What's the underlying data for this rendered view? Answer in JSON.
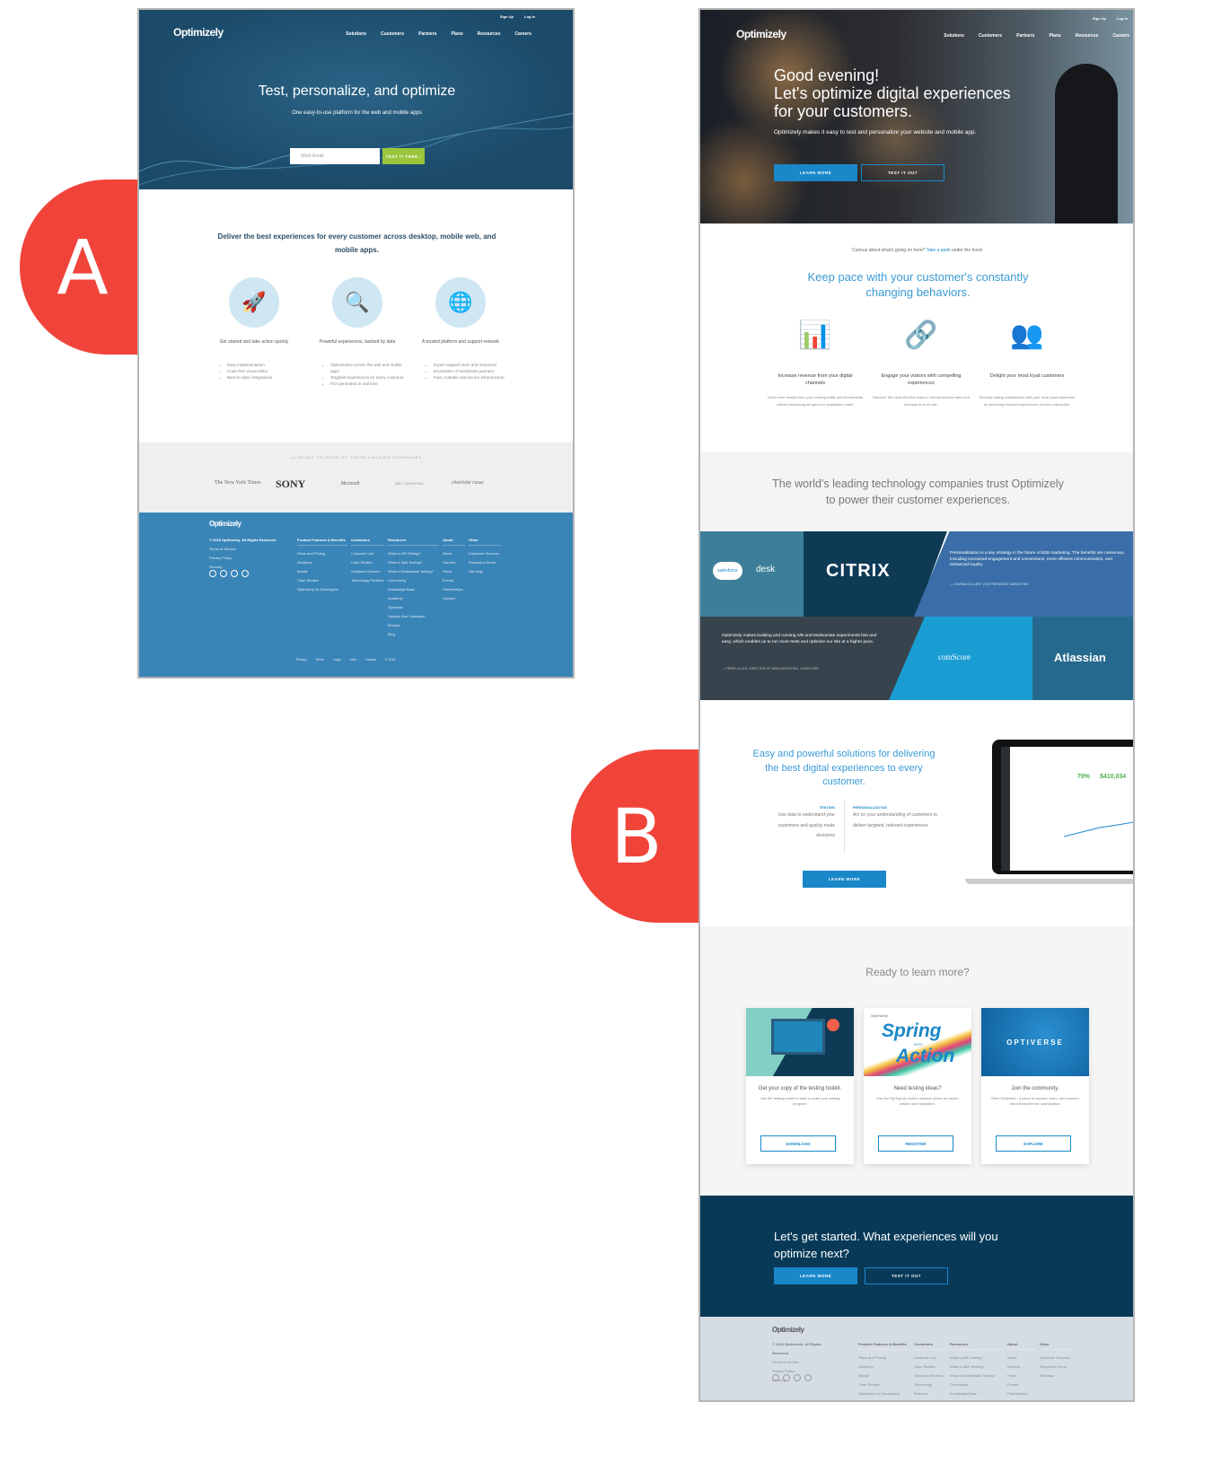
{
  "variant_a": {
    "badge": "A",
    "brand": "Optimizely",
    "top_links": [
      "Sign Up",
      "Log In"
    ],
    "nav": [
      "Solutions",
      "Customers",
      "Partners",
      "Plans",
      "Resources",
      "Careers"
    ],
    "hero": {
      "title": "Test, personalize, and optimize",
      "subtitle": "One easy-to-use platform for the web and mobile apps",
      "email_placeholder": "Work Email",
      "cta": "TEST IT FREE ›"
    },
    "section_title": "Deliver the best experiences for every customer across desktop, mobile web, and mobile apps.",
    "features": [
      {
        "icon": "rocket-icon",
        "title": "Get started and take action quickly",
        "bullets": [
          "Easy implementation",
          "Code-free visual editor",
          "Best-in-class integrations"
        ]
      },
      {
        "icon": "magnifier-icon",
        "title": "Powerful experiences, backed by data",
        "bullets": [
          "Optimization across the web and mobile apps",
          "Targeted experiences for every customer",
          "ROI generated in real time"
        ]
      },
      {
        "icon": "globe-icon",
        "title": "A trusted platform and support network",
        "bullets": [
          "Expert support team and resources",
          "Ecosystem of worldclass partners",
          "Fast, scalable and secure infrastructure"
        ]
      }
    ],
    "trusted_label": "ALREADY TRUSTED BY THESE AMAZING COMPANIES",
    "logos": [
      "The New York Times",
      "SONY",
      "Microsoft",
      "NBC UNIVERSAL",
      "charlotte russe"
    ],
    "footer": {
      "copyright": "© 2016 Optimizely. All Rights Reserved.",
      "links": [
        "Terms of Service",
        "Privacy Policy",
        "Security"
      ],
      "columns": [
        {
          "title": "Product Features & Benefits",
          "items": [
            "Plans and Pricing",
            "Solutions",
            "Mobile",
            "Case Studies",
            "Optimizely for Developers"
          ]
        },
        {
          "title": "Customers",
          "items": [
            "Customer List",
            "Case Studies",
            "Solutions Partners",
            "Technology Partners"
          ]
        },
        {
          "title": "Resources",
          "items": [
            "What is A/B Testing?",
            "What is Split Testing?",
            "What is Multivariate Testing?",
            "Community",
            "Knowledge Base",
            "Academy",
            "Optiverse",
            "Sample Size Calculator",
            "Ebooks",
            "Blog"
          ]
        },
        {
          "title": "About",
          "items": [
            "About",
            "Careers",
            "Press",
            "Events",
            "Partnerships",
            "Contact"
          ]
        },
        {
          "title": "Other",
          "items": [
            "Customer Success",
            "Request a Demo",
            "Site Map"
          ]
        }
      ],
      "bottom": [
        "Privacy",
        "Terms",
        "Legal",
        "Jobs",
        "Contact",
        "© 2016"
      ]
    }
  },
  "variant_b": {
    "badge": "B",
    "brand": "Optimizely",
    "top_links": [
      "Sign Up",
      "Log In"
    ],
    "nav": [
      "Solutions",
      "Customers",
      "Partners",
      "Plans",
      "Resources",
      "Careers"
    ],
    "hero": {
      "title_lines": [
        "Good evening!",
        "Let's optimize digital experiences",
        "for your customers."
      ],
      "subtitle": "Optimizely makes it easy to test and personalize your website and mobile app.",
      "primary": "LEARN MORE",
      "secondary": "TEST IT OUT"
    },
    "peek": {
      "before": "Curious about what's going on here?",
      "link": "Take a peek",
      "after": "under the hood."
    },
    "section_title": "Keep pace with your customer's constantly changing behaviors.",
    "features": [
      {
        "icon": "bar-chart-icon",
        "title": "Increase revenue from your digital channels",
        "desc": "Drive more results from your existing traffic and investments without increasing ad spend or acquisition costs."
      },
      {
        "icon": "share-nodes-icon",
        "title": "Engage your visitors with compelling experiences",
        "desc": "Discover the most effective ways to reduce bounce rates and increase time on site."
      },
      {
        "icon": "users-heart-icon",
        "title": "Delight your most loyal customers",
        "desc": "Develop lasting relationships with your most loyal customers by delivering relevant experiences at every interaction."
      }
    ],
    "trust_title": "The world's leading technology companies trust Optimizely to power their customer experiences.",
    "mosaic": {
      "logos": [
        "salesforce",
        "desk",
        "CITRIX",
        "comScore",
        "Atlassian"
      ],
      "quote1": "Personalization is a key strategy in the future of B2B marketing. The benefits are numerous, including increased engagement and conversions, more efficient communication, and enhanced loyalty.",
      "quote1_by": "— JOANNA COLLIER, VICE PRESIDENT, MARKETING",
      "quote2": "Optimizely makes building and running A/B and Multivariate experiments fast and easy, which enables us to run more tests and optimize our site at a higher pace.",
      "quote2_by": "— PERRY ALLEN, DIRECTOR OF WEB MARKETING, COMSCORE"
    },
    "solutions": {
      "title": "Easy and powerful solutions for delivering the best digital experiences to every customer.",
      "testing_label": "TESTING",
      "testing": "Use data to understand your customers and quickly make decisions",
      "personalization_label": "PERSONALIZATION",
      "personalization": "Act on your understanding of customers to deliver targeted, relevant experiences",
      "cta": "LEARN MORE",
      "screen_stats": [
        "79%",
        "$410,034"
      ]
    },
    "learn_title": "Ready to learn more?",
    "cards": [
      {
        "title": "Get your copy of the testing toolkit.",
        "desc": "Use the testing toolkit to start or scale your testing program.",
        "button": "DOWNLOAD"
      },
      {
        "title": "Need testing ideas?",
        "desc": "Join the Spring into Action webinar series for expert advice and inspiration.",
        "button": "REGISTER",
        "art": [
          "Optimizely",
          "Spring",
          "INTO",
          "Action"
        ]
      },
      {
        "title": "Join the community.",
        "desc": "Meet Optiverse - a place to explore, learn, and connect around experience optimization.",
        "button": "EXPLORE",
        "art": [
          "OPTIVERSE"
        ]
      }
    ],
    "cta_band": {
      "title": "Let's get started. What experiences will you optimize next?",
      "primary": "LEARN MORE",
      "secondary": "TEST IT OUT"
    },
    "footer": {
      "copyright": "© 2016 Optimizely. All Rights Reserved.",
      "links": [
        "Terms of Service",
        "Privacy Policy",
        "Security"
      ],
      "columns": [
        {
          "title": "Product Features & Benefits",
          "items": [
            "Plans and Pricing",
            "Solutions",
            "Mobile",
            "Case Studies",
            "Optimizely for Developers"
          ]
        },
        {
          "title": "Customers",
          "items": [
            "Customer List",
            "Case Studies",
            "Solutions Partners",
            "Technology Partners"
          ]
        },
        {
          "title": "Resources",
          "items": [
            "What is A/B Testing?",
            "What is Split Testing?",
            "What is Multivariate Testing?",
            "Community",
            "Knowledge Base"
          ]
        },
        {
          "title": "About",
          "items": [
            "About",
            "Careers",
            "Press",
            "Events",
            "Partnerships"
          ]
        },
        {
          "title": "Other",
          "items": [
            "Customer Success",
            "Request a Demo",
            "Site Map"
          ]
        }
      ]
    }
  },
  "colors": {
    "badge": "#f0443a",
    "a_header": "#1f4e6e",
    "a_cta": "#9bc53d",
    "a_footer": "#3a85b8",
    "b_accent": "#1a87c9",
    "b_cta_band": "#083a58",
    "b_footer": "#d5dde2"
  }
}
